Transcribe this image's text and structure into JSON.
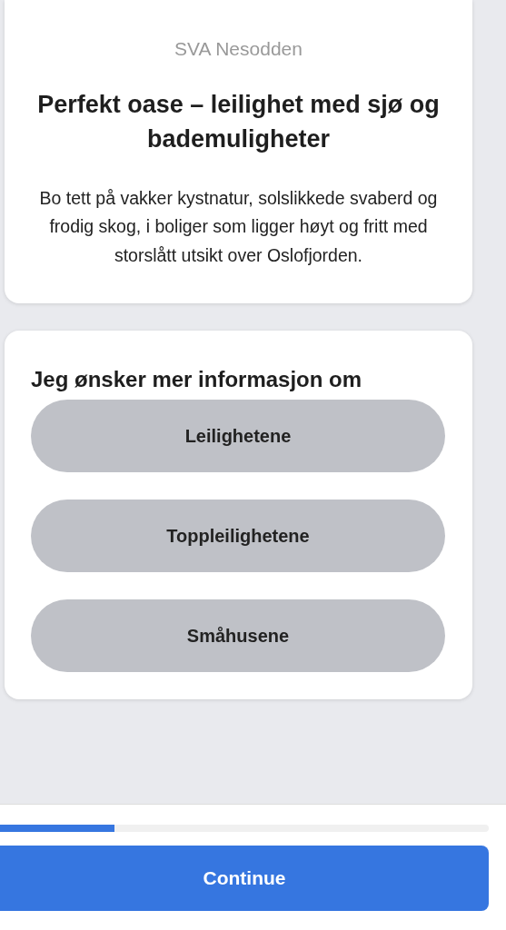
{
  "intro": {
    "brand": "SVA Nesodden",
    "title": "Perfekt oase – leilighet med sjø og bademuligheter",
    "description": "Bo tett på vakker kystnatur, solslikkede svaberd og frodig skog, i boliger som ligger høyt og fritt med storslått utsikt over Oslofjorden."
  },
  "question": {
    "heading": "Jeg ønsker mer informasjon om",
    "options": [
      {
        "label": "Leilighetene",
        "selected": false
      },
      {
        "label": "Toppleilighetene",
        "selected": false
      },
      {
        "label": "Småhusene",
        "selected": false
      }
    ]
  },
  "progress": {
    "level": 0.235
  },
  "continue_button": "Continue"
}
